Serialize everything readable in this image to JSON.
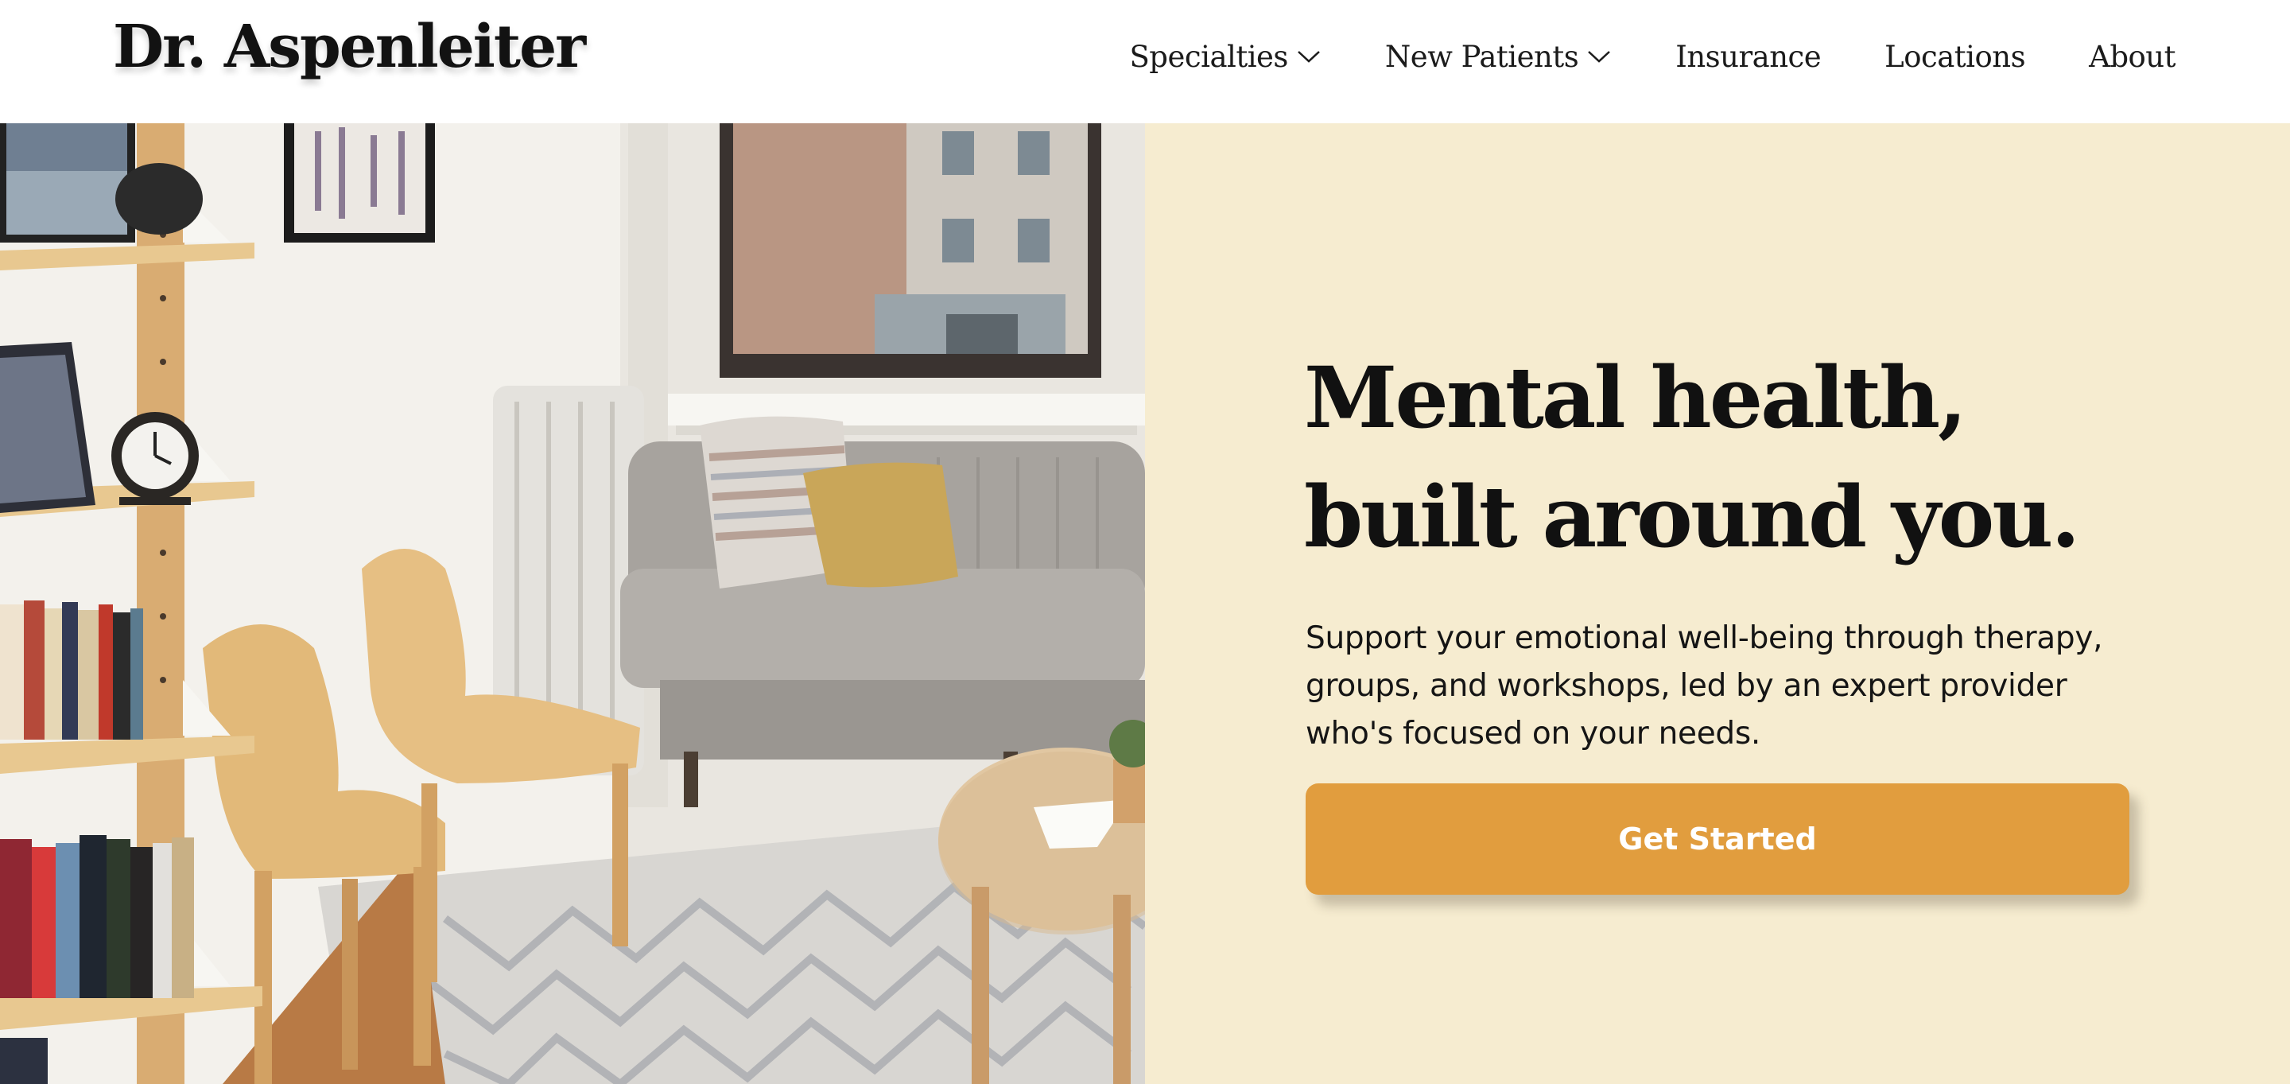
{
  "brand": {
    "logo_text": "Dr. Aspenleiter"
  },
  "nav": {
    "items": [
      {
        "label": "Specialties",
        "has_dropdown": true
      },
      {
        "label": "New Patients",
        "has_dropdown": true
      },
      {
        "label": "Insurance",
        "has_dropdown": false
      },
      {
        "label": "Locations",
        "has_dropdown": false
      },
      {
        "label": "About",
        "has_dropdown": false
      }
    ]
  },
  "hero": {
    "headline_line1": "Mental health,",
    "headline_line2": "built around you.",
    "subtext": "Support your emotional well-being through therapy, groups, and workshops, led by an expert provider who's focused on your needs.",
    "cta_label": "Get Started",
    "image_alt": "Therapy office waiting room with chairs, sofa, bookshelf and window"
  },
  "colors": {
    "panel_background": "#f6ecd0",
    "cta_background": "#e19d3e",
    "cta_text": "#ffffff",
    "text": "#111111"
  }
}
